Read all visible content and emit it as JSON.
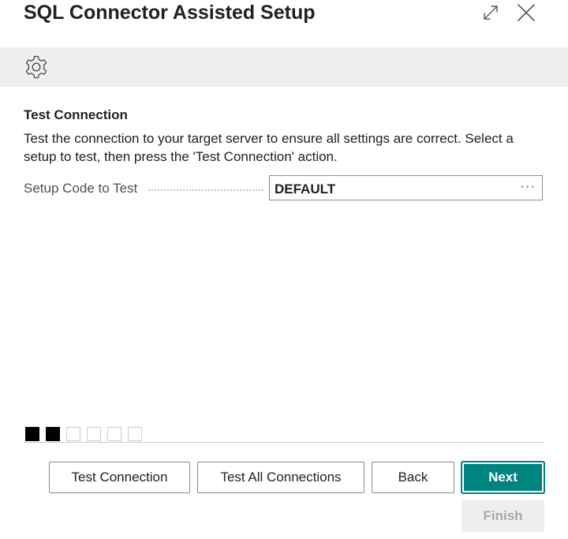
{
  "window": {
    "title": "SQL Connector Assisted Setup",
    "expand_icon": "expand-icon",
    "close_icon": "close-icon"
  },
  "toolbar": {
    "settings_icon": "gear-icon"
  },
  "step": {
    "title": "Test Connection",
    "instructions": "Test the connection to your target server to ensure all settings are correct. Select a setup to test, then press the 'Test Connection' action."
  },
  "field": {
    "label": "Setup Code to Test",
    "value": "DEFAULT",
    "lookup_label": "···"
  },
  "progress": {
    "total_steps": 6,
    "completed_steps": 2
  },
  "buttons": {
    "test_connection": "Test Connection",
    "test_all_connections": "Test All Connections",
    "back": "Back",
    "next": "Next",
    "finish": "Finish"
  },
  "colors": {
    "primary": "#00847f",
    "step_done": "#000000",
    "toolbar_bg": "#efefef",
    "disabled_bg": "#eeeeee"
  }
}
